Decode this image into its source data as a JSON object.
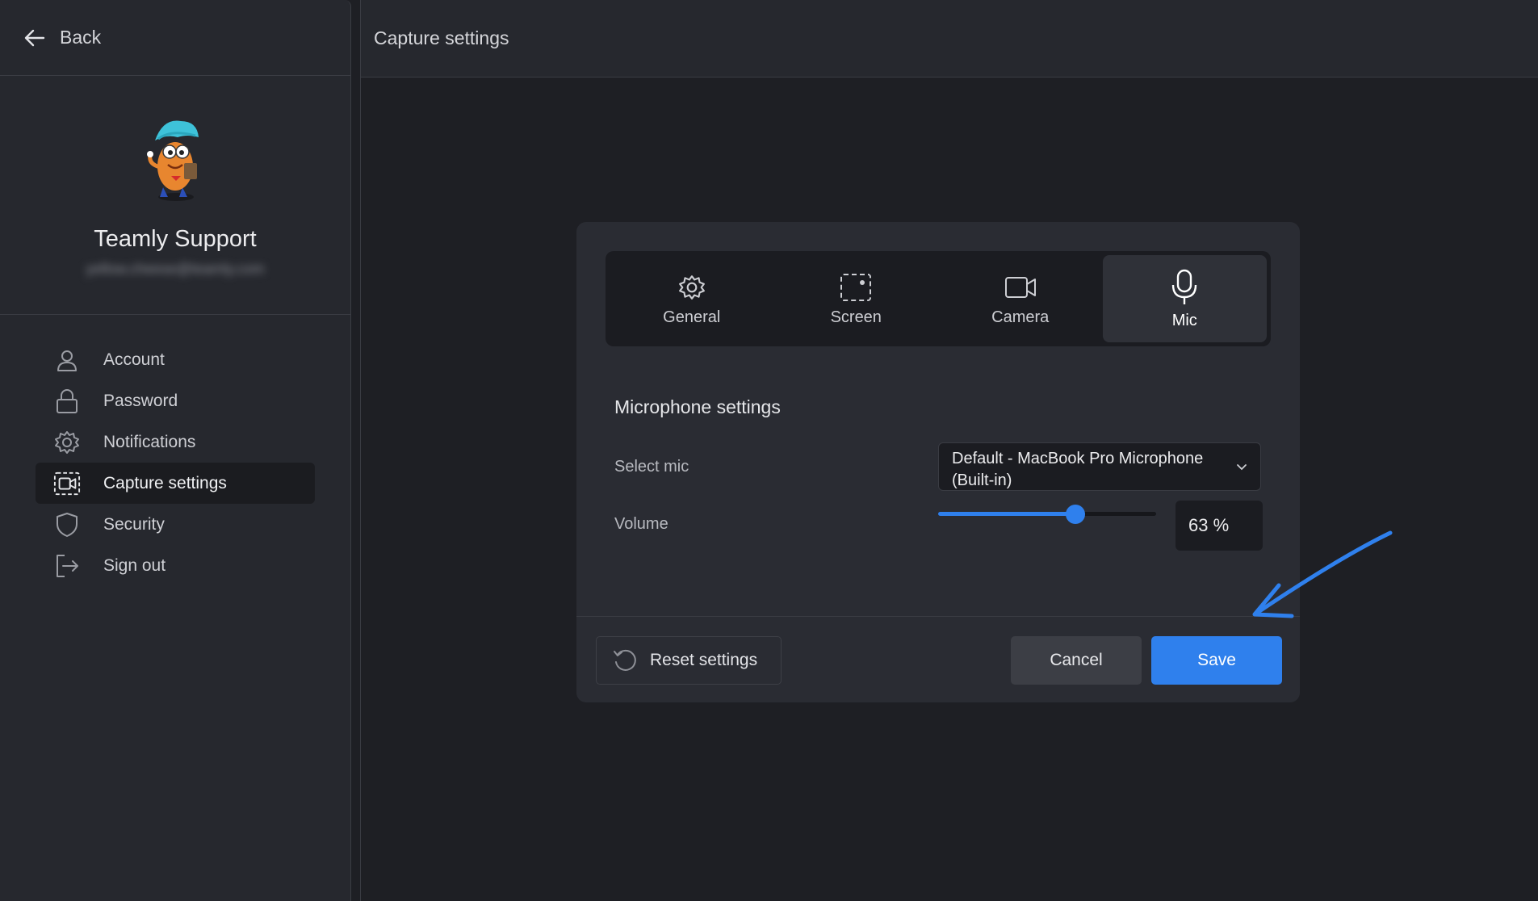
{
  "sidebar": {
    "back_label": "Back",
    "profile": {
      "name": "Teamly Support",
      "email": "yellow.cheese@teamly.com"
    },
    "items": [
      {
        "label": "Account",
        "icon": "user-icon",
        "active": false
      },
      {
        "label": "Password",
        "icon": "lock-icon",
        "active": false
      },
      {
        "label": "Notifications",
        "icon": "gear-icon",
        "active": false
      },
      {
        "label": "Capture settings",
        "icon": "capture-icon",
        "active": true
      },
      {
        "label": "Security",
        "icon": "shield-icon",
        "active": false
      },
      {
        "label": "Sign out",
        "icon": "sign-out-icon",
        "active": false
      }
    ]
  },
  "main": {
    "title": "Capture settings"
  },
  "modal": {
    "tabs": [
      {
        "label": "General",
        "icon": "gear-icon"
      },
      {
        "label": "Screen",
        "icon": "screen-capture-icon"
      },
      {
        "label": "Camera",
        "icon": "camera-icon"
      },
      {
        "label": "Mic",
        "icon": "microphone-icon",
        "active": true
      }
    ],
    "section_title": "Microphone settings",
    "select_mic_label": "Select mic",
    "selected_mic": "Default - MacBook Pro Microphone (Built-in)",
    "volume_label": "Volume",
    "volume_value": 63,
    "volume_display": "63 %",
    "reset_label": "Reset settings",
    "cancel_label": "Cancel",
    "save_label": "Save"
  },
  "colors": {
    "accent": "#2f80ed",
    "background": "#1e1f24",
    "panel": "#26282e"
  }
}
